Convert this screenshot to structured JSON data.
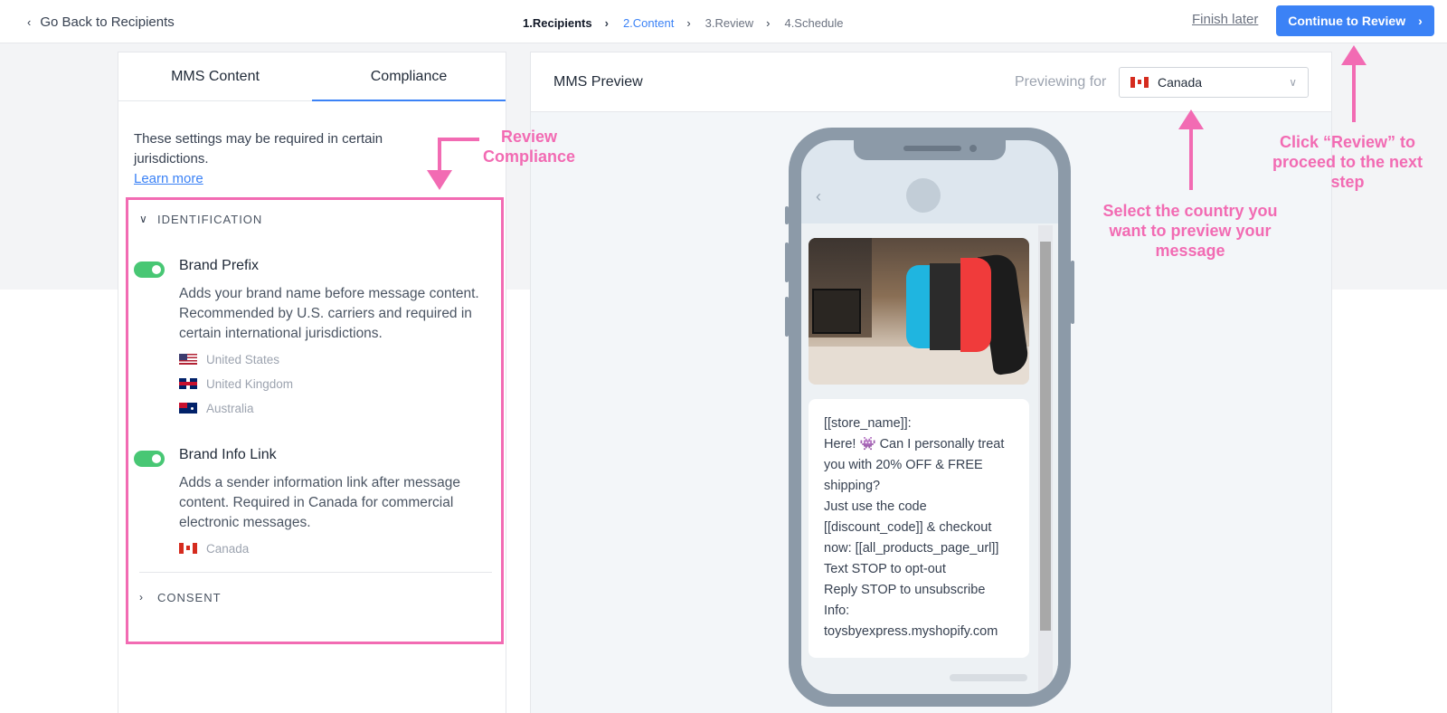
{
  "topbar": {
    "back_label": "Go Back to Recipients",
    "steps": [
      {
        "label": "1.Recipients",
        "state": "done"
      },
      {
        "label": "2.Content",
        "state": "active"
      },
      {
        "label": "3.Review",
        "state": "upcoming"
      },
      {
        "label": "4.Schedule",
        "state": "upcoming"
      }
    ],
    "finish_later": "Finish later",
    "continue_label": "Continue to Review"
  },
  "left_panel": {
    "tabs": [
      {
        "label": "MMS Content",
        "active": false
      },
      {
        "label": "Compliance",
        "active": true
      }
    ],
    "intro": "These settings may be required in certain jurisdictions.",
    "learn_more": "Learn more",
    "identification": {
      "header": "IDENTIFICATION",
      "settings": [
        {
          "title": "Brand Prefix",
          "enabled": true,
          "description": "Adds your brand name before message content. Recommended by U.S. carriers and required in certain international jurisdictions.",
          "countries": [
            "United States",
            "United Kingdom",
            "Australia"
          ]
        },
        {
          "title": "Brand Info Link",
          "enabled": true,
          "description": "Adds a sender information link after message content. Required in Canada for commercial electronic messages.",
          "countries": [
            "Canada"
          ]
        }
      ]
    },
    "consent": {
      "header": "CONSENT"
    }
  },
  "preview": {
    "title": "MMS Preview",
    "previewing_for": "Previewing for",
    "selected_country": "Canada",
    "message_lines": [
      "[[store_name]]:",
      "Here! 👾 Can I personally treat",
      "you with 20% OFF & FREE",
      "shipping?",
      "Just use the code",
      "[[discount_code]] & checkout",
      "now: [[all_products_page_url]]",
      "Text STOP to opt-out",
      "Reply STOP to unsubscribe",
      "Info:",
      "toysbyexpress.myshopify.com"
    ]
  },
  "annotations": {
    "compliance": "Review Compliance",
    "country": "Select the country you want to preview your message",
    "review": "Click “Review” to proceed to the next step"
  },
  "colors": {
    "accent": "#3b82f6",
    "annotation": "#f26bb3",
    "toggle_on": "#48c774"
  },
  "icons": {
    "back": "chevron-left-icon",
    "step_separator": "chevron-right-icon",
    "continue": "chevron-right-icon",
    "section_open": "chevron-down-icon",
    "section_closed": "chevron-right-icon",
    "select": "chevron-down-icon"
  }
}
